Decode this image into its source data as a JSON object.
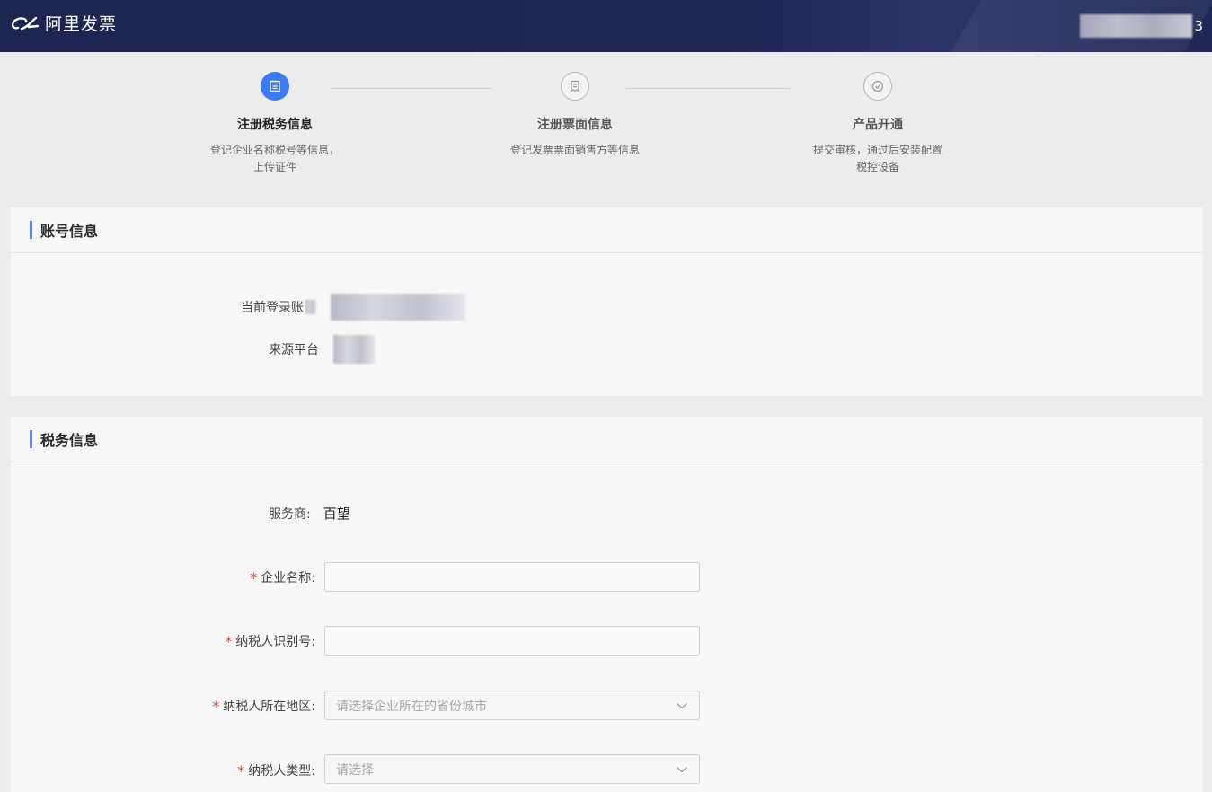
{
  "header": {
    "brand": "阿里发票",
    "user_suffix": "3"
  },
  "steps": [
    {
      "title": "注册税务信息",
      "desc": "登记企业名称税号等信息，上传证件",
      "state": "active",
      "icon": "building-icon"
    },
    {
      "title": "注册票面信息",
      "desc": "登记发票票面销售方等信息",
      "state": "pending",
      "icon": "invoice-icon"
    },
    {
      "title": "产品开通",
      "desc": "提交审核，通过后安装配置税控设备",
      "state": "pending",
      "icon": "check-circle-icon"
    }
  ],
  "account": {
    "section_title": "账号信息",
    "login_label": "当前登录账",
    "platform_label": "来源平台"
  },
  "tax": {
    "section_title": "税务信息",
    "provider_label": "服务商:",
    "provider_value": "百望",
    "company_label": "企业名称:",
    "taxid_label": "纳税人识别号:",
    "region_label": "纳税人所在地区:",
    "region_placeholder": "请选择企业所在的省份城市",
    "type_label": "纳税人类型:",
    "type_placeholder": "请选择",
    "required_mark": "*"
  },
  "colors": {
    "header_bg": "#1d2450",
    "accent": "#3a7cf5",
    "section_bar": "#5a86e8",
    "required": "#e23a3a"
  }
}
